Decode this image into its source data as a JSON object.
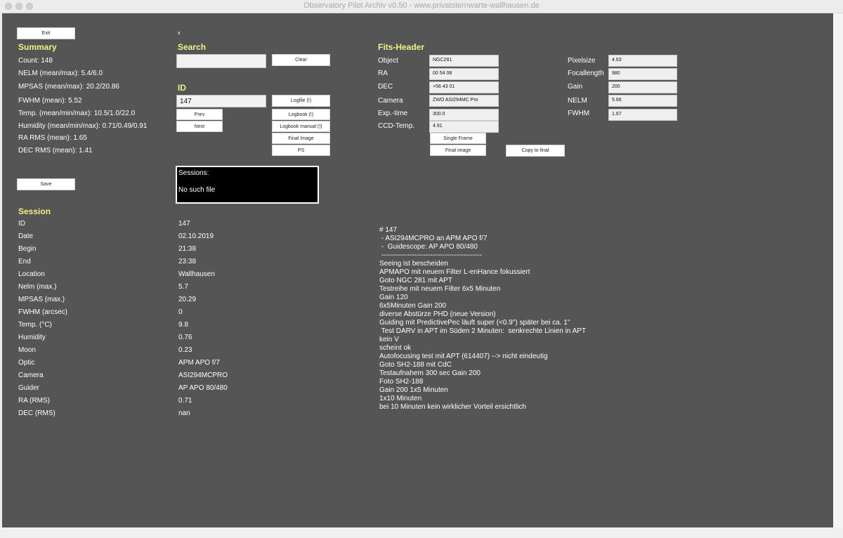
{
  "window": {
    "title": "Observatory Pilot Archiv v0.50 - www.privatsternwarte-wallhausen.de"
  },
  "buttons": {
    "exit": "Exit",
    "save": "Save",
    "clear": "Clear",
    "prev": "Prev",
    "next": "Next",
    "logfile": "Logfile (!)",
    "logbook": "Logbook (!)",
    "logbook_manual": "Logbook manual (!)",
    "final_image": "Final Image",
    "ps": "PS",
    "single_frame": "Single Frame",
    "final_image_fits": "Final image",
    "copy_to_final": "Copy to final"
  },
  "top_marker": "x",
  "summary": {
    "heading": "Summary",
    "lines": [
      "Count: 148",
      "NELM (mean/max): 5.4/6.0",
      "MPSAS (mean/max): 20.2/20.86",
      "FWHM (mean): 5.52",
      "Temp. (mean/min/max): 10.5/1.0/22.0",
      "Humidity (mean/min/max): 0.71/0.49/0.91",
      "RA RMS (mean): 1.65",
      "DEC RMS (mean): 1.41"
    ]
  },
  "search": {
    "heading": "Search",
    "value": ""
  },
  "id": {
    "heading": "ID",
    "value": "147"
  },
  "sessions": {
    "label": "Sessions:",
    "message": "No such file"
  },
  "fits": {
    "heading": "Fits-Header",
    "left": [
      {
        "label": "Object",
        "value": "NGC281"
      },
      {
        "label": "RA",
        "value": "00 54 08"
      },
      {
        "label": "DEC",
        "value": "+56 43 01"
      },
      {
        "label": "Camera",
        "value": "ZWO ASI294MC Pro"
      },
      {
        "label": "Exp.-time",
        "value": "300.0"
      },
      {
        "label": "CCD-Temp.",
        "value": "4.91"
      }
    ],
    "right": [
      {
        "label": "Pixelsize",
        "value": "4.63"
      },
      {
        "label": "Focallength",
        "value": "980"
      },
      {
        "label": "Gain",
        "value": "200"
      },
      {
        "label": "NELM",
        "value": "5.66"
      },
      {
        "label": "FWHM",
        "value": "1.67"
      }
    ]
  },
  "session": {
    "heading": "Session",
    "rows": [
      {
        "label": "ID",
        "value": "147"
      },
      {
        "label": "Date",
        "value": "02.10.2019"
      },
      {
        "label": "Begin",
        "value": "21:38"
      },
      {
        "label": "End",
        "value": "23:38"
      },
      {
        "label": "Location",
        "value": "Wallhausen"
      },
      {
        "label": "Nelm (max.)",
        "value": "5.7"
      },
      {
        "label": "MPSAS (max.)",
        "value": "20.29"
      },
      {
        "label": "FWHM (arcsec)",
        "value": "0"
      },
      {
        "label": "Temp. (°C)",
        "value": "9.8"
      },
      {
        "label": "Humidity",
        "value": "0.76"
      },
      {
        "label": "Moon",
        "value": "0.23"
      },
      {
        "label": "Optic",
        "value": "APM APO f/7"
      },
      {
        "label": "Camera",
        "value": "ASI294MCPRO"
      },
      {
        "label": "Guider",
        "value": "AP APO 80/480"
      },
      {
        "label": "RA (RMS)",
        "value": "0.71"
      },
      {
        "label": "DEC (RMS)",
        "value": "nan"
      }
    ]
  },
  "log_lines": [
    "# 147",
    " - ASI294MCPRO an APM APO f/7",
    " -  Guidescope: AP APO 80/480",
    " -------------------------------------------",
    "Seeing ist bescheiden",
    "APMAPO mit neuem Filter L-enHance fokussiert",
    "Goto NGC 281 mit APT",
    "Testreihe mit neuem Filter 6x5 Minuten",
    "Gain 120",
    "6x5Minuten Gain 200",
    "diverse Abstürze PHD (neue Version)",
    "Guiding mit PredictivePec läuft super (<0.9\") später bei ca. 1\"",
    " Test DARV in APT im Süden 2 Minuten:  senkrechte Linien in APT",
    "kein V",
    "scheint ok",
    "Autofocusing test mit APT (614407) --> nicht eindeutig",
    "Goto SH2-188 mit CdC",
    "Testaufnahem 300 sec Gain 200",
    "Foto SH2-188",
    "Gain 200 1x5 Minuten",
    "1x10 Minuten",
    "bei 10 Minuten kein wirklicher Vorteil ersichtlich"
  ]
}
